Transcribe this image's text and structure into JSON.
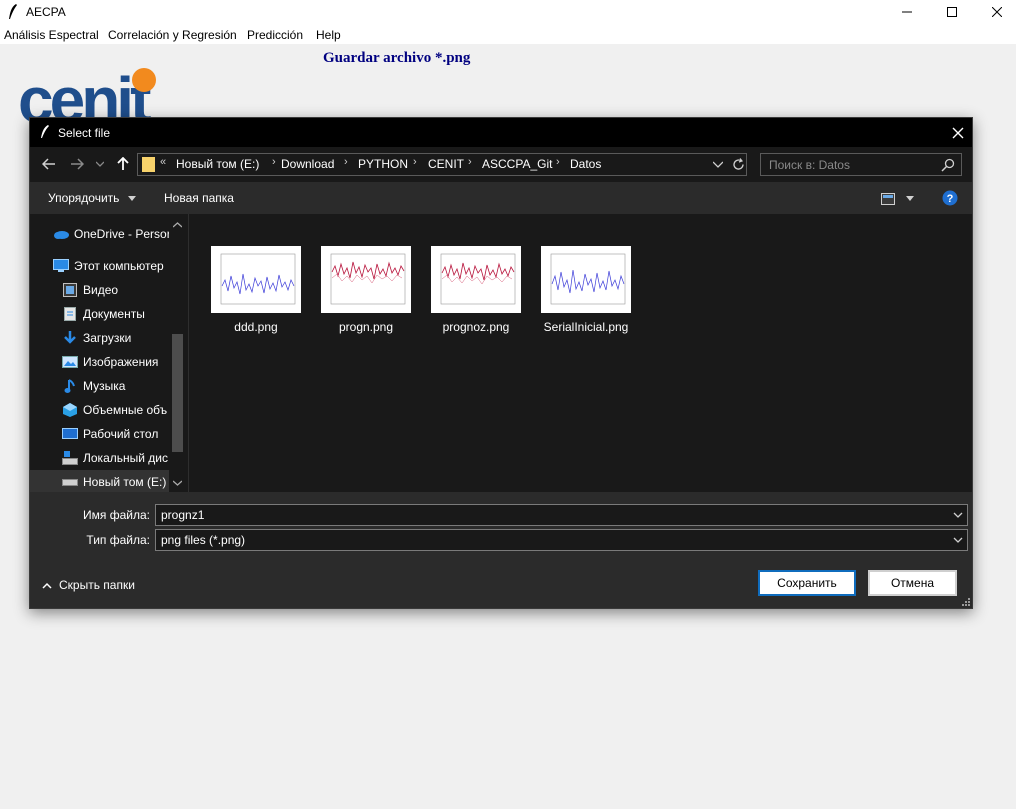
{
  "app": {
    "title": "AECPA",
    "menu": [
      "Análisis Espectral",
      "Correlación y Regresión",
      "Predicción",
      "Help"
    ],
    "heading": "Guardar archivo *.png",
    "logo_text": "cenit"
  },
  "dialog": {
    "title": "Select file",
    "address": {
      "overflow": "«",
      "crumbs": [
        "Новый том (E:)",
        "Download",
        "PYTHON",
        "CENIT",
        "ASCCPA_Git",
        "Datos"
      ]
    },
    "search_placeholder": "Поиск в: Datos",
    "toolbar": {
      "organize": "Упорядочить",
      "new_folder": "Новая папка"
    },
    "sidebar": [
      {
        "label": "OneDrive - Persor",
        "icon": "onedrive-icon"
      },
      {
        "label": "Этот компьютер",
        "icon": "computer-icon"
      },
      {
        "label": "Видео",
        "icon": "video-icon"
      },
      {
        "label": "Документы",
        "icon": "documents-icon"
      },
      {
        "label": "Загрузки",
        "icon": "downloads-icon"
      },
      {
        "label": "Изображения",
        "icon": "pictures-icon"
      },
      {
        "label": "Музыка",
        "icon": "music-icon"
      },
      {
        "label": "Объемные объ",
        "icon": "3d-objects-icon"
      },
      {
        "label": "Рабочий стол",
        "icon": "desktop-icon"
      },
      {
        "label": "Локальный дис",
        "icon": "local-disk-icon"
      },
      {
        "label": "Новый том (E:)",
        "icon": "drive-icon"
      }
    ],
    "files": [
      {
        "name": "ddd.png",
        "color": "#3a3ad8"
      },
      {
        "name": "progn.png",
        "color": "#b8143c"
      },
      {
        "name": "prognoz.png",
        "color": "#b8143c"
      },
      {
        "name": "SerialInicial.png",
        "color": "#3a3ad8"
      }
    ],
    "filename_label": "Имя файла:",
    "filename_value": "prognz1",
    "filetype_label": "Тип файла:",
    "filetype_value": "png files (*.png)",
    "hide_folders": "Скрыть папки",
    "save_button": "Сохранить",
    "cancel_button": "Отмена"
  },
  "colors": {
    "heading": "#000080",
    "dialog_bg": "#191919",
    "accent": "#0f6cbd",
    "logo_blue": "#1f4e8c",
    "logo_orange": "#f28a1e"
  }
}
